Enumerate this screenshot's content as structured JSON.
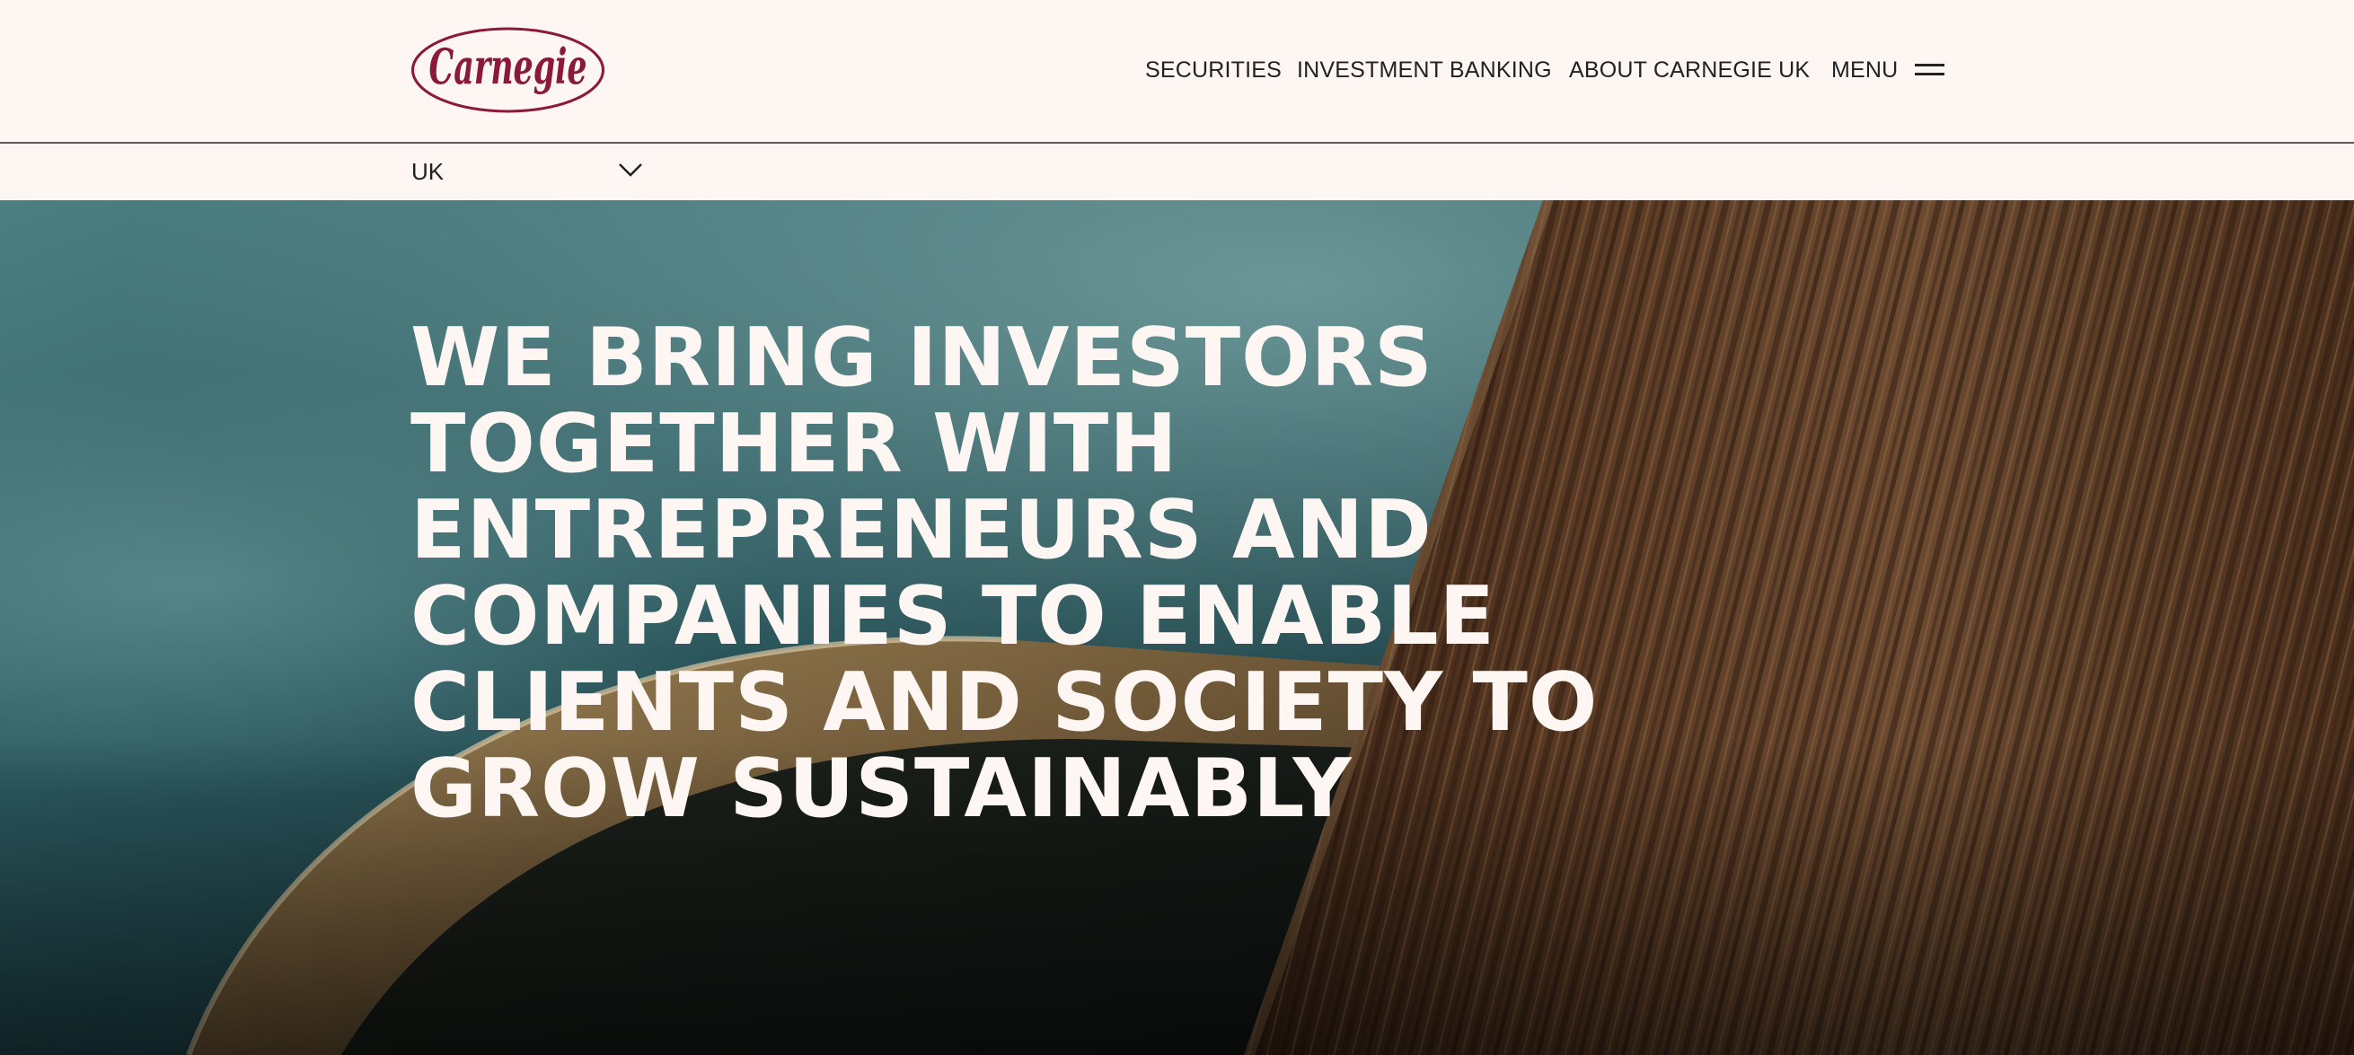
{
  "brand": {
    "logo_text": "Carnegie",
    "logo_color": "#8b1a3a"
  },
  "nav": {
    "items": [
      {
        "label": "SECURITIES"
      },
      {
        "label": "INVESTMENT BANKING"
      },
      {
        "label": "ABOUT CARNEGIE UK"
      }
    ],
    "menu_label": "MENU"
  },
  "region": {
    "selected": "UK"
  },
  "hero": {
    "headline": "WE BRING INVESTORS TOGETHER WITH ENTREPRENEURS AND COMPANIES TO ENABLE CLIENTS AND SOCIETY TO GROW SUSTAINABLY"
  },
  "colors": {
    "background": "#fdf6f2",
    "text": "#222222",
    "hero_text": "#fdf6f2",
    "accent": "#8b1a3a"
  }
}
